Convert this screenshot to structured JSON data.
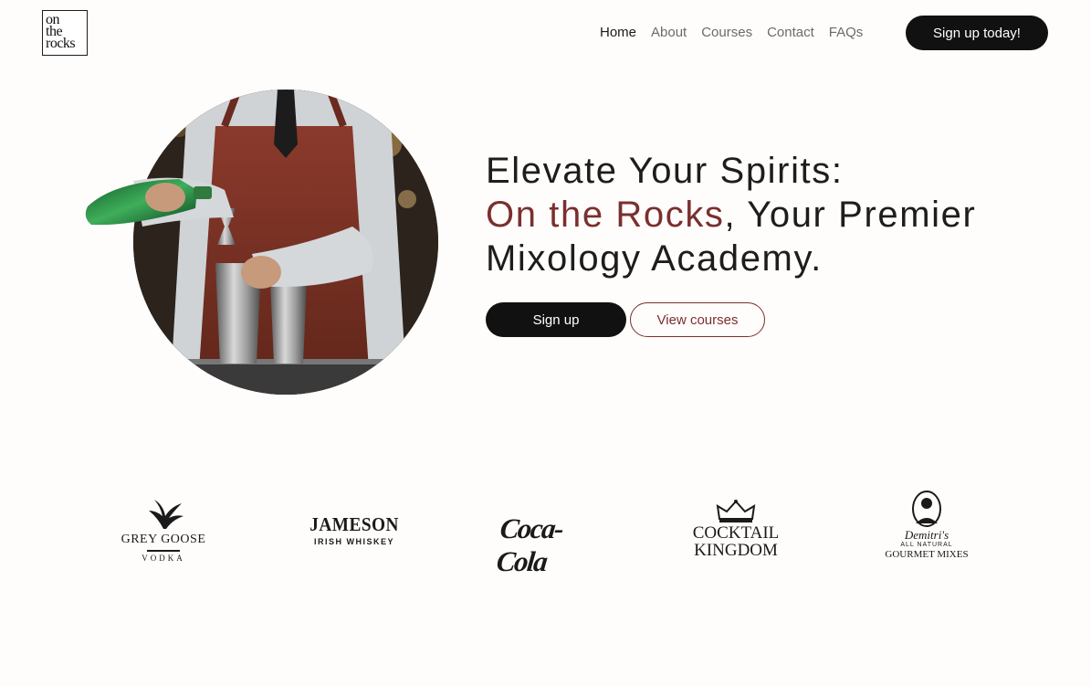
{
  "header": {
    "logo_lines": [
      "on",
      "the",
      "rocks"
    ],
    "nav": [
      {
        "label": "Home",
        "active": true
      },
      {
        "label": "About",
        "active": false
      },
      {
        "label": "Courses",
        "active": false
      },
      {
        "label": "Contact",
        "active": false
      },
      {
        "label": "FAQs",
        "active": false
      }
    ],
    "cta_label": "Sign up today!"
  },
  "hero": {
    "headline_line1": "Elevate Your Spirits:",
    "headline_accent": "On the Rocks",
    "headline_rest": ", Your Premier Mixology Academy.",
    "primary_button": "Sign up",
    "secondary_button": "View courses",
    "image_icon": "bartender-photo"
  },
  "brands": [
    {
      "line1": "GREY GOOSE",
      "line2": "VODKA",
      "icon": "goose-icon"
    },
    {
      "line1": "JAMESON",
      "line2": "IRISH WHISKEY",
      "icon": "jameson-wordmark"
    },
    {
      "line1": "Coca-Cola",
      "line2": "",
      "icon": "coca-cola-wordmark"
    },
    {
      "line1": "COCKTAIL",
      "line2": "KINGDOM",
      "icon": "crown-icon"
    },
    {
      "line1": "Demitri's",
      "line2": "ALL NATURAL",
      "line3": "GOURMET MIXES",
      "icon": "portrait-icon"
    }
  ],
  "colors": {
    "accent": "#7a2f2f",
    "button_dark": "#111111",
    "background": "#fffdfb"
  }
}
